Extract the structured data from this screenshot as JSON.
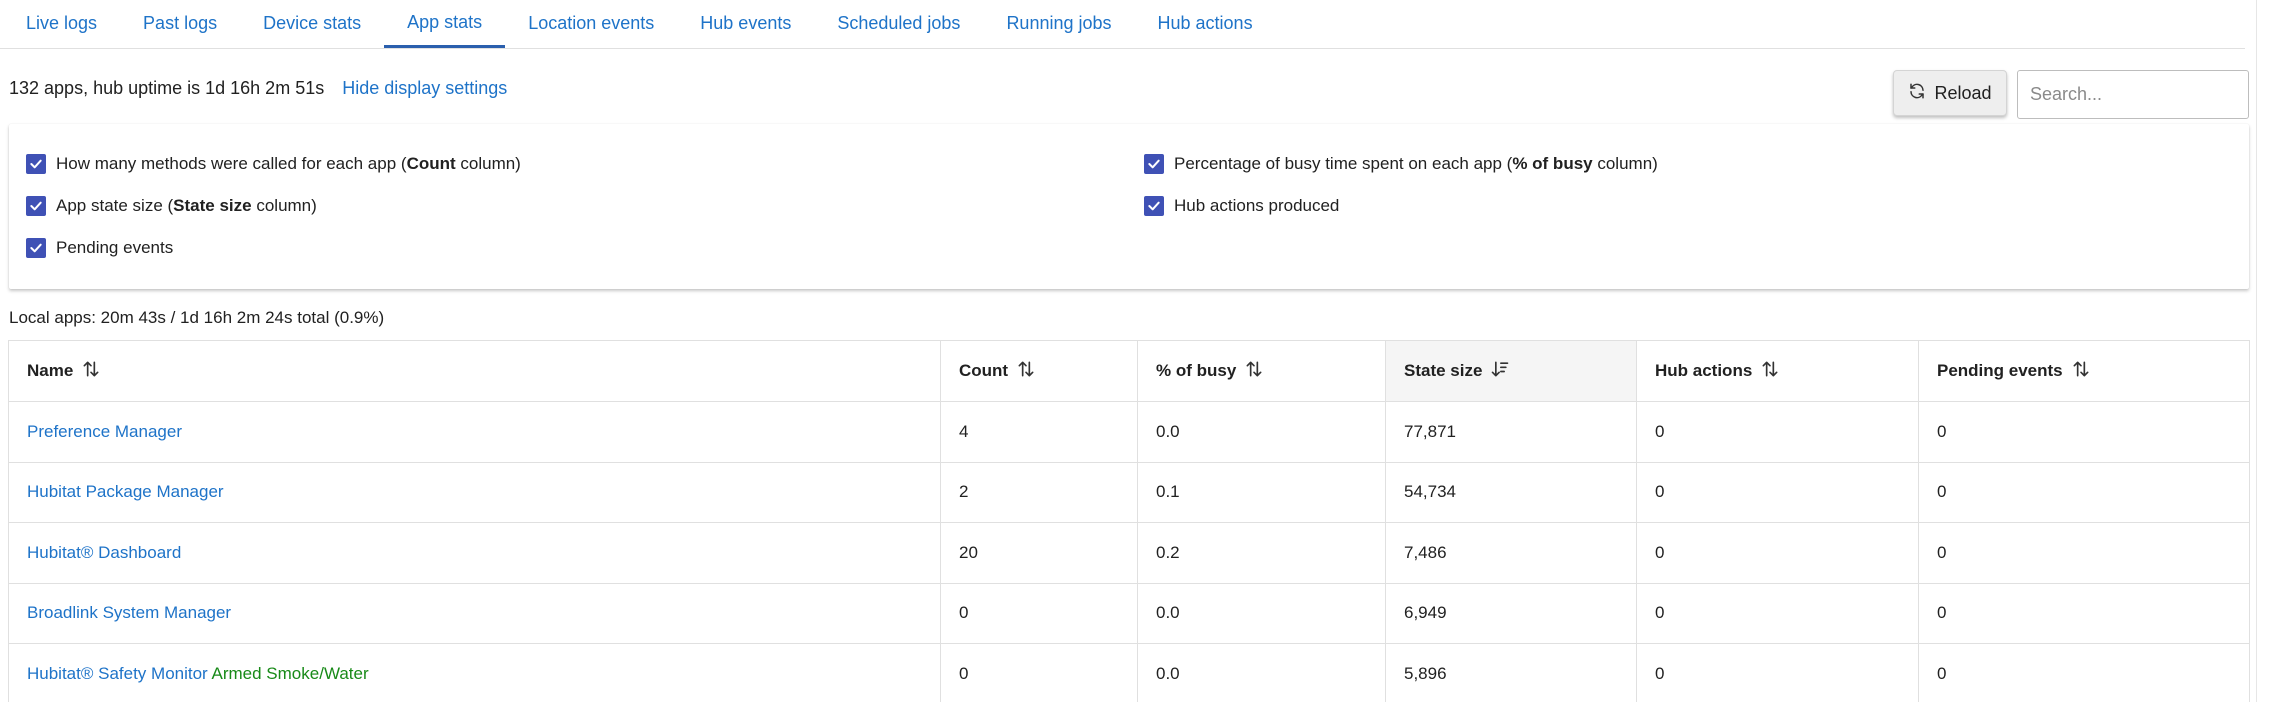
{
  "tabs": [
    {
      "label": "Live logs",
      "active": false
    },
    {
      "label": "Past logs",
      "active": false
    },
    {
      "label": "Device stats",
      "active": false
    },
    {
      "label": "App stats",
      "active": true
    },
    {
      "label": "Location events",
      "active": false
    },
    {
      "label": "Hub events",
      "active": false
    },
    {
      "label": "Scheduled jobs",
      "active": false
    },
    {
      "label": "Running jobs",
      "active": false
    },
    {
      "label": "Hub actions",
      "active": false
    }
  ],
  "summary": {
    "text": "132 apps, hub uptime is 1d 16h 2m 51s",
    "toggle_link": "Hide display settings"
  },
  "toolbar": {
    "reload_label": "Reload",
    "search_placeholder": "Search..."
  },
  "settings": {
    "count": {
      "before": "How many methods were called for each app (",
      "bold": "Count",
      "after": " column)",
      "checked": true
    },
    "busy": {
      "before": "Percentage of busy time spent on each app (",
      "bold": "% of busy",
      "after": " column)",
      "checked": true
    },
    "state": {
      "before": "App state size (",
      "bold": "State size",
      "after": " column)",
      "checked": true
    },
    "hub_actions": {
      "label": "Hub actions produced",
      "checked": true
    },
    "pending": {
      "label": "Pending events",
      "checked": true
    }
  },
  "local_apps": "Local apps: 20m 43s / 1d 16h 2m 24s total (0.9%)",
  "table": {
    "headers": {
      "name": "Name",
      "count": "Count",
      "busy": "% of busy",
      "state": "State size",
      "hub_actions": "Hub actions",
      "pending": "Pending events"
    },
    "sorted_column": "state",
    "rows": [
      {
        "name": "Preference Manager",
        "status": "",
        "count": "4",
        "busy": "0.0",
        "state": "77,871",
        "hub_actions": "0",
        "pending": "0"
      },
      {
        "name": "Hubitat Package Manager",
        "status": "",
        "count": "2",
        "busy": "0.1",
        "state": "54,734",
        "hub_actions": "0",
        "pending": "0"
      },
      {
        "name": "Hubitat® Dashboard",
        "status": "",
        "count": "20",
        "busy": "0.2",
        "state": "7,486",
        "hub_actions": "0",
        "pending": "0"
      },
      {
        "name": "Broadlink System Manager",
        "status": "",
        "count": "0",
        "busy": "0.0",
        "state": "6,949",
        "hub_actions": "0",
        "pending": "0"
      },
      {
        "name": "Hubitat® Safety Monitor",
        "status": "Armed Smoke/Water",
        "count": "0",
        "busy": "0.0",
        "state": "5,896",
        "hub_actions": "0",
        "pending": "0"
      }
    ]
  },
  "colors": {
    "link": "#1e73c8",
    "active_tab_underline": "#2a5fad",
    "checkbox": "#3f51b5",
    "status_green": "#188a18"
  }
}
